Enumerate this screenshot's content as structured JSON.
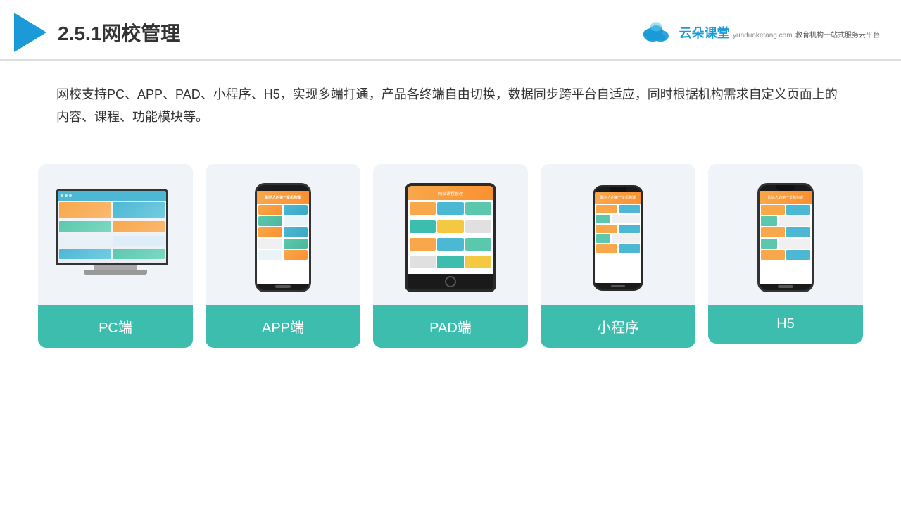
{
  "header": {
    "title": "2.5.1网校管理",
    "brand": {
      "name": "云朵课堂",
      "url": "yunduoketang.com",
      "slogan": "教育机构一站式服务云平台"
    }
  },
  "description": "网校支持PC、APP、PAD、小程序、H5，实现多端打通，产品各终端自由切换，数据同步跨平台自适应，同时根据机构需求自定义页面上的内容、课程、功能模块等。",
  "cards": [
    {
      "label": "PC端",
      "type": "pc"
    },
    {
      "label": "APP端",
      "type": "app"
    },
    {
      "label": "PAD端",
      "type": "pad"
    },
    {
      "label": "小程序",
      "type": "miniapp"
    },
    {
      "label": "H5",
      "type": "h5"
    }
  ]
}
